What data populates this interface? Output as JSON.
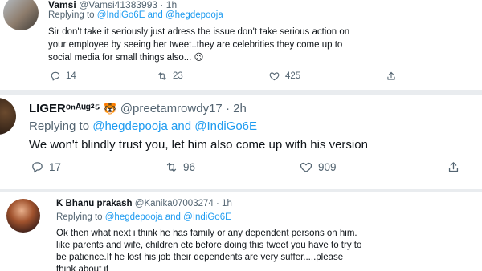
{
  "tweets": [
    {
      "name": "Vamsi",
      "handle": "@Vamsi41383993",
      "time": "1h",
      "replying_prefix": "Replying to",
      "mentions": [
        "@IndiGo6E",
        "@hegdepooja"
      ],
      "and_word": "and",
      "body_lines": [
        "Sir don't take it seriously just adress the issue don't take serious action on",
        "your employee by seeing her tweet..they are celebrities they come up to",
        "social media for small things also..."
      ],
      "body_emoji": "😉",
      "replies": "14",
      "retweets": "23",
      "likes": "425"
    },
    {
      "name": "LIGER",
      "name_suffix": "ᵒⁿᴬᵘᵍ²⁵",
      "name_badge": "🐯",
      "handle": "@preetamrowdy17",
      "time": "2h",
      "replying_prefix": "Replying to",
      "mentions": [
        "@hegdepooja",
        "@IndiGo6E"
      ],
      "and_word": "and",
      "body_lines": [
        "We won't blindly trust you, let him also come up with his version"
      ],
      "replies": "17",
      "retweets": "96",
      "likes": "909"
    },
    {
      "name": "K Bhanu prakash",
      "handle": "@Kanika07003274",
      "time": "1h",
      "replying_prefix": "Replying to",
      "mentions": [
        "@hegdepooja",
        "@IndiGo6E"
      ],
      "and_word": "and",
      "body_lines": [
        "Ok then what next i think he has family or any dependent persons on him.",
        "like parents and wife, children etc before doing this tweet you have to try to",
        "be patience.If he lost his job their dependents are very suffer.....please",
        "think about it"
      ]
    }
  ],
  "separator": "·",
  "icons": {
    "reply": "reply-icon",
    "retweet": "retweet-icon",
    "like": "heart-icon",
    "share": "share-icon"
  },
  "colors": {
    "accent": "#1d9bf0",
    "text": "#0f1419",
    "muted": "#536471"
  }
}
